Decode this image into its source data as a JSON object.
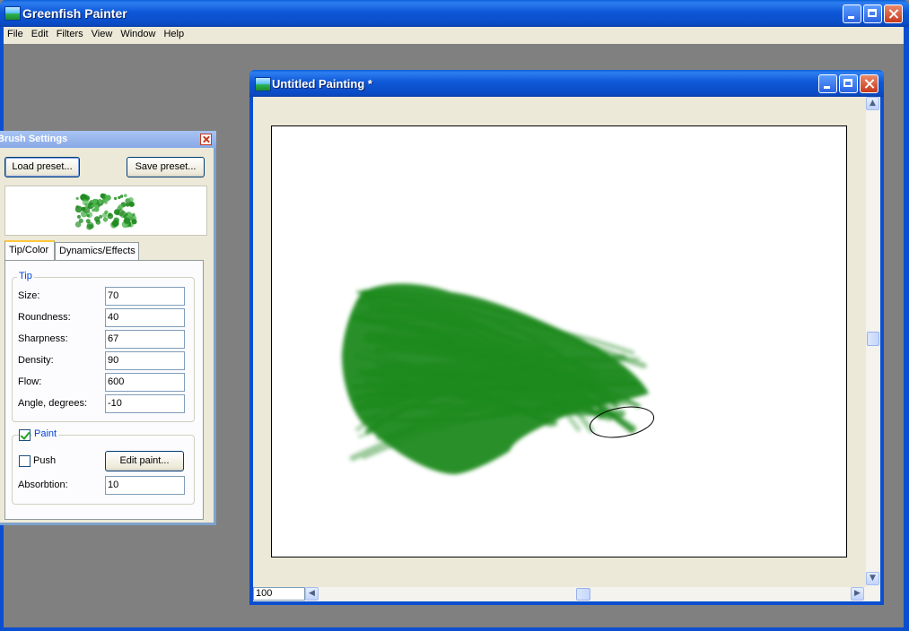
{
  "app": {
    "title": "Greenfish Painter",
    "icon": "app-landscape-icon"
  },
  "menubar": {
    "items": [
      "File",
      "Edit",
      "Filters",
      "View",
      "Window",
      "Help"
    ]
  },
  "child_window": {
    "title": "Untitled Painting *",
    "zoom_value": "100"
  },
  "brush_settings": {
    "title": "Brush Settings",
    "load_preset": "Load preset...",
    "save_preset": "Save preset...",
    "tabs": [
      "Tip/Color",
      "Dynamics/Effects"
    ],
    "tip_group": "Tip",
    "fields": {
      "size": {
        "label": "Size:",
        "value": "70"
      },
      "roundness": {
        "label": "Roundness:",
        "value": "40"
      },
      "sharpness": {
        "label": "Sharpness:",
        "value": "67"
      },
      "density": {
        "label": "Density:",
        "value": "90"
      },
      "flow": {
        "label": "Flow:",
        "value": "600"
      },
      "angle": {
        "label": "Angle, degrees:",
        "value": "-10"
      }
    },
    "paint_group": "Paint",
    "paint_checked": true,
    "push_label": "Push",
    "push_checked": false,
    "edit_paint": "Edit paint...",
    "absorption_label": "Absorbtion:",
    "absorption_value": "10"
  },
  "colors": {
    "paint": "#1f8a1f",
    "titlebar": "#0a4bc4",
    "workspace": "#808080"
  }
}
